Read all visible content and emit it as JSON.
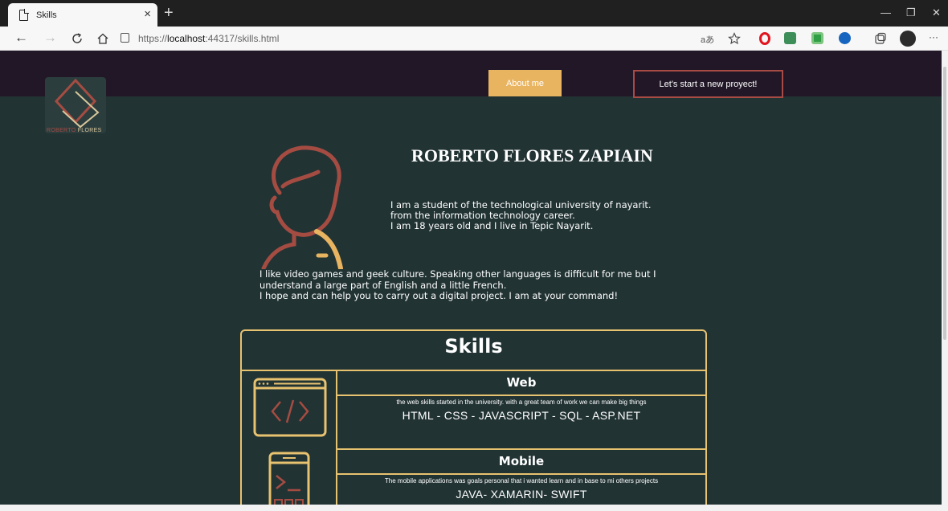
{
  "browser": {
    "tab_title": "Skills",
    "tab_close": "×",
    "new_tab": "+",
    "url_prefix": "https://",
    "url_host": "localhost",
    "url_rest": ":44317/skills.html",
    "read_aloud": "aあ",
    "minimize": "—",
    "restore": "❐",
    "close": "✕",
    "more": "···",
    "icons": [
      "back-icon",
      "forward-icon",
      "refresh-icon",
      "home-icon",
      "lock-icon",
      "favorite-icon",
      "opera-icon",
      "extension-icon",
      "extension-icon",
      "extension-icon",
      "collections-icon",
      "profile-icon"
    ]
  },
  "logo": {
    "text_first": "ROBERTO",
    "text_last": "FLORES",
    "colors": {
      "primary": "#a54c42",
      "secondary": "#d8c79c"
    }
  },
  "nav": {
    "about_label": "About me",
    "project_label": "Let's start a new proyect!"
  },
  "profile": {
    "name": "ROBERTO FLORES ZAPIAIN",
    "intro_lines": [
      "I am a student of the technological university of nayarit.",
      "from the information technology career.",
      "I am 18 years old and I live in Tepic Nayarit."
    ],
    "bio_lines": [
      "I like video games and geek culture. Speaking other languages is difficult for me but I",
      "understand a large part of English and a little French.",
      "I hope and can help you to carry out a digital project. I am at your command!"
    ]
  },
  "skills": {
    "title": "Skills",
    "items": [
      {
        "title": "Web",
        "description": "the web skills started in the university. with a great team of work we can make big things",
        "list": "HTML  -  CSS  -  JAVASCRIPT  -  SQL  -  ASP.NET",
        "icon": "code-window-icon"
      },
      {
        "title": "Mobile",
        "description": "The mobile applications was goals personal that i wanted learn and in base to mi others projects",
        "list": "JAVA-  XAMARIN-  SWIFT",
        "icon": "mobile-phone-icon"
      }
    ]
  },
  "colors": {
    "background": "#223334",
    "header": "#211726",
    "accent_gold": "#e7c26f",
    "accent_red": "#a74b44",
    "button_gold": "#e9b460"
  }
}
